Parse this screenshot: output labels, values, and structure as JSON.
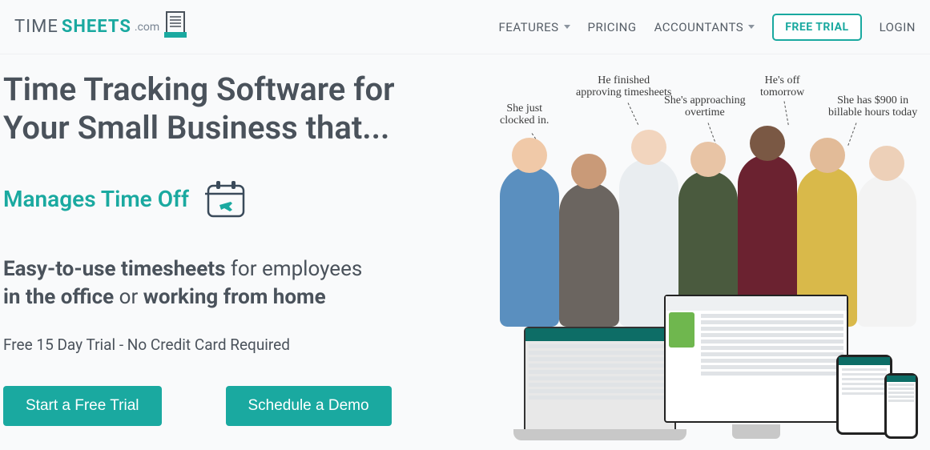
{
  "logo": {
    "pre": "TIME",
    "mid": "SHEETS",
    "post": ".com"
  },
  "nav": {
    "features": "FEATURES",
    "pricing": "PRICING",
    "accountants": "ACCOUNTANTS",
    "free_trial": "FREE TRIAL",
    "login": "LOGIN"
  },
  "hero": {
    "headline_l1": "Time Tracking Software for",
    "headline_l2": "Your Small Business that...",
    "rotating": "Manages Time Off",
    "sub_bold1": "Easy-to-use timesheets",
    "sub_plain1": " for employees",
    "sub_bold2": "in the office",
    "sub_plain2": " or ",
    "sub_bold3": "working from home",
    "trial_note": "Free 15 Day Trial - No Credit Card Required",
    "cta_start": "Start a Free Trial",
    "cta_demo": "Schedule a Demo"
  },
  "annotations": {
    "a1": "She just\nclocked in.",
    "a2": "He finished\napproving timesheets",
    "a3": "She's approaching\novertime",
    "a4": "He's off\ntomorrow",
    "a5": "She has $900 in\nbillable hours today"
  }
}
